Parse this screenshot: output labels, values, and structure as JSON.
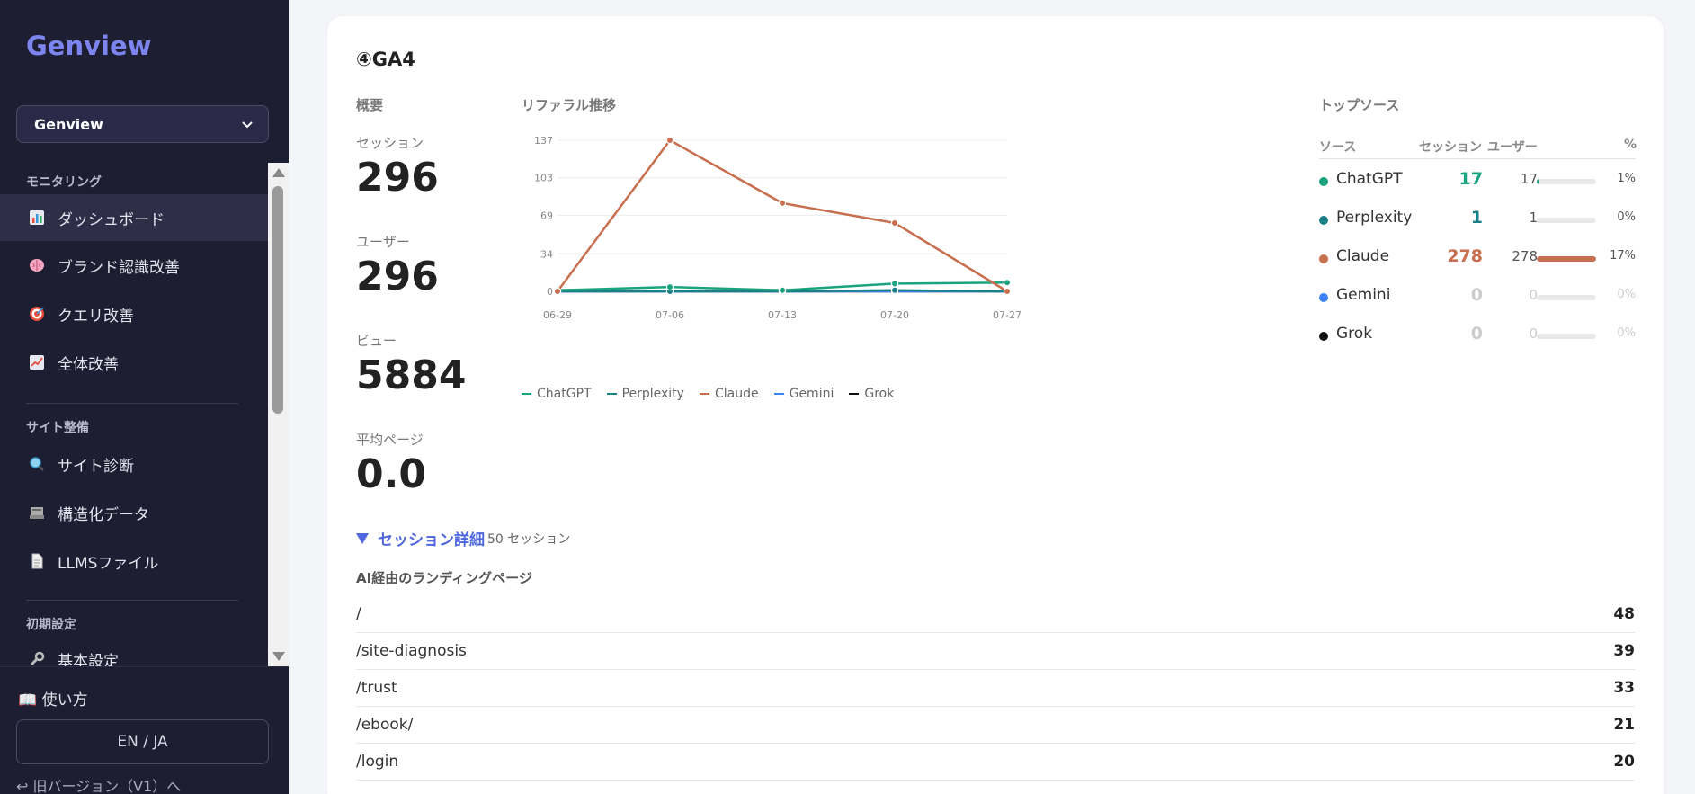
{
  "sidebar": {
    "brand": "Genview",
    "project_select": "Genview",
    "sections": [
      {
        "label": "モニタリング"
      },
      {
        "label": "サイト整備"
      },
      {
        "label": "初期設定"
      }
    ],
    "items": [
      {
        "label": "ダッシュボード",
        "icon": "bar-chart-icon",
        "active": true
      },
      {
        "label": "ブランド認識改善",
        "icon": "brain-icon"
      },
      {
        "label": "クエリ改善",
        "icon": "target-icon"
      },
      {
        "label": "全体改善",
        "icon": "trend-chart-icon"
      },
      {
        "label": "サイト診断",
        "icon": "magnifier-icon"
      },
      {
        "label": "構造化データ",
        "icon": "structure-icon"
      },
      {
        "label": "LLMSファイル",
        "icon": "document-icon"
      },
      {
        "label": "基本設定",
        "icon": "wrench-icon"
      }
    ],
    "howto": "📖 使い方",
    "lang_toggle": "EN / JA",
    "old_version": "↩ 旧バージョン（V1）へ"
  },
  "card": {
    "title": "④GA4",
    "overview_label": "概要",
    "referral_label": "リファラル推移",
    "top_sources_label": "トップソース",
    "metrics": [
      {
        "label": "セッション",
        "value": "296"
      },
      {
        "label": "ユーザー",
        "value": "296"
      },
      {
        "label": "ビュー",
        "value": "5884"
      },
      {
        "label": "平均ページ",
        "value": "0.0"
      }
    ]
  },
  "chart_data": {
    "type": "line",
    "x": [
      "06-29",
      "07-06",
      "07-13",
      "07-20",
      "07-27"
    ],
    "y_ticks": [
      0,
      34,
      69,
      103,
      137
    ],
    "ylim": [
      0,
      137
    ],
    "grid": true,
    "legend_position": "bottom-left",
    "series": [
      {
        "name": "ChatGPT",
        "color": "#1aa37f",
        "values": [
          1,
          4,
          1,
          7,
          8
        ]
      },
      {
        "name": "Perplexity",
        "color": "#1a7f86",
        "values": [
          0,
          0,
          0,
          1,
          0
        ]
      },
      {
        "name": "Claude",
        "color": "#c86f4f",
        "values": [
          0,
          137,
          80,
          62,
          0
        ]
      },
      {
        "name": "Gemini",
        "color": "#3b82f6",
        "values": [
          0,
          0,
          0,
          0,
          0
        ]
      },
      {
        "name": "Grok",
        "color": "#111111",
        "values": [
          0,
          0,
          0,
          0,
          0
        ]
      }
    ]
  },
  "top_sources": {
    "headers": {
      "source": "ソース",
      "sessions": "セッション",
      "users": "ユーザー",
      "pct": "%"
    },
    "rows": [
      {
        "name": "ChatGPT",
        "color": "#1aa37f",
        "sessions": "17",
        "users": "17",
        "pct": "1%",
        "share": 0.01
      },
      {
        "name": "Perplexity",
        "color": "#1a7f86",
        "sessions": "1",
        "users": "1",
        "pct": "0%",
        "share": 0.0
      },
      {
        "name": "Claude",
        "color": "#c86f4f",
        "sessions": "278",
        "users": "278",
        "pct": "17%",
        "share": 1.0
      },
      {
        "name": "Gemini",
        "color": "#3b82f6",
        "sessions": "0",
        "users": "0",
        "pct": "0%",
        "share": 0.0
      },
      {
        "name": "Grok",
        "color": "#111111",
        "sessions": "0",
        "users": "0",
        "pct": "0%",
        "share": 0.0
      }
    ]
  },
  "session_detail": {
    "toggle_label": "セッション詳細",
    "count_label": "50 セッション",
    "landing_title": "AI経由のランディングページ",
    "landing_pages": [
      {
        "path": "/",
        "count": "48"
      },
      {
        "path": "/site-diagnosis",
        "count": "39"
      },
      {
        "path": "/trust",
        "count": "33"
      },
      {
        "path": "/ebook/",
        "count": "21"
      },
      {
        "path": "/login",
        "count": "20"
      }
    ]
  }
}
